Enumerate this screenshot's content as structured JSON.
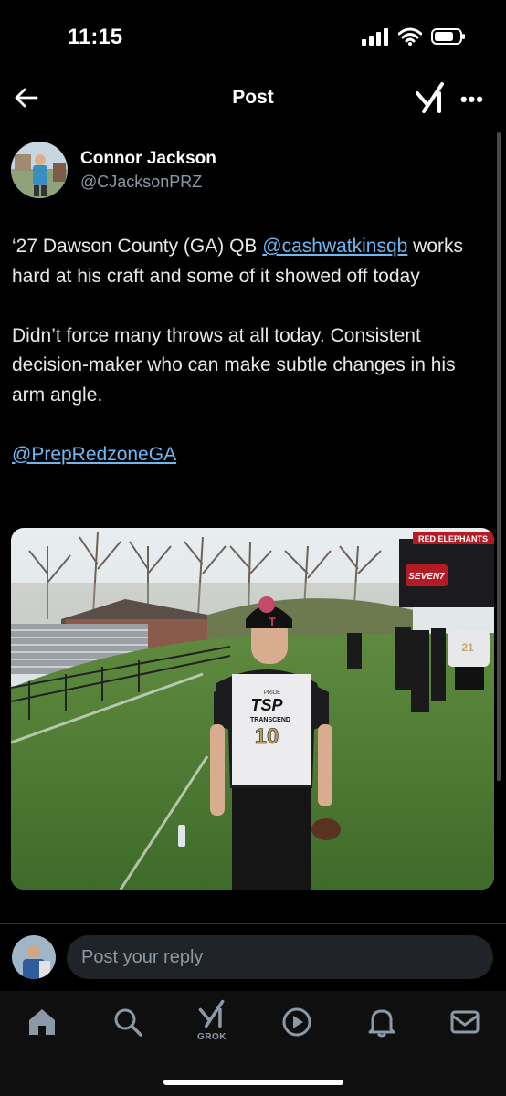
{
  "status_bar": {
    "time": "11:15"
  },
  "header": {
    "title": "Post",
    "back_icon": "arrow-left-icon",
    "grok_icon": "grok-icon",
    "more_icon": "more-horizontal-icon",
    "more_label": "•••"
  },
  "author": {
    "name": "Connor Jackson",
    "handle": "@CJacksonPRZ"
  },
  "tweet": {
    "para1_text": "‘27 Dawson County (GA) QB ",
    "para1_mention": "@cashwatkinsqb",
    "para1_rest": " works hard at his craft and some of it showed off today",
    "para2": "Didn’t force many throws at all today. Consistent decision-maker who can make subtle changes in his arm angle.",
    "para3_mention": "@PrepRedzoneGA"
  },
  "photo": {
    "scoreboard_text": "RED ELEPHANTS",
    "banner_text": "SEVEN7",
    "jersey_brand": "TSP",
    "jersey_sub": "TRANSCEND",
    "jersey_number": "10",
    "jersey_small": "PRIDE",
    "jersey_right_number": "21"
  },
  "reply": {
    "placeholder": "Post your reply"
  },
  "tabbar": {
    "items": [
      {
        "name": "home",
        "icon": "home-icon"
      },
      {
        "name": "search",
        "icon": "search-icon"
      },
      {
        "name": "grok",
        "icon": "grok-icon",
        "label": "GROK"
      },
      {
        "name": "video",
        "icon": "play-circle-icon"
      },
      {
        "name": "notifications",
        "icon": "bell-icon"
      },
      {
        "name": "messages",
        "icon": "mail-icon"
      }
    ]
  },
  "colors": {
    "background": "#000000",
    "link": "#6fb7f0",
    "secondary_text": "#8b98a5"
  }
}
